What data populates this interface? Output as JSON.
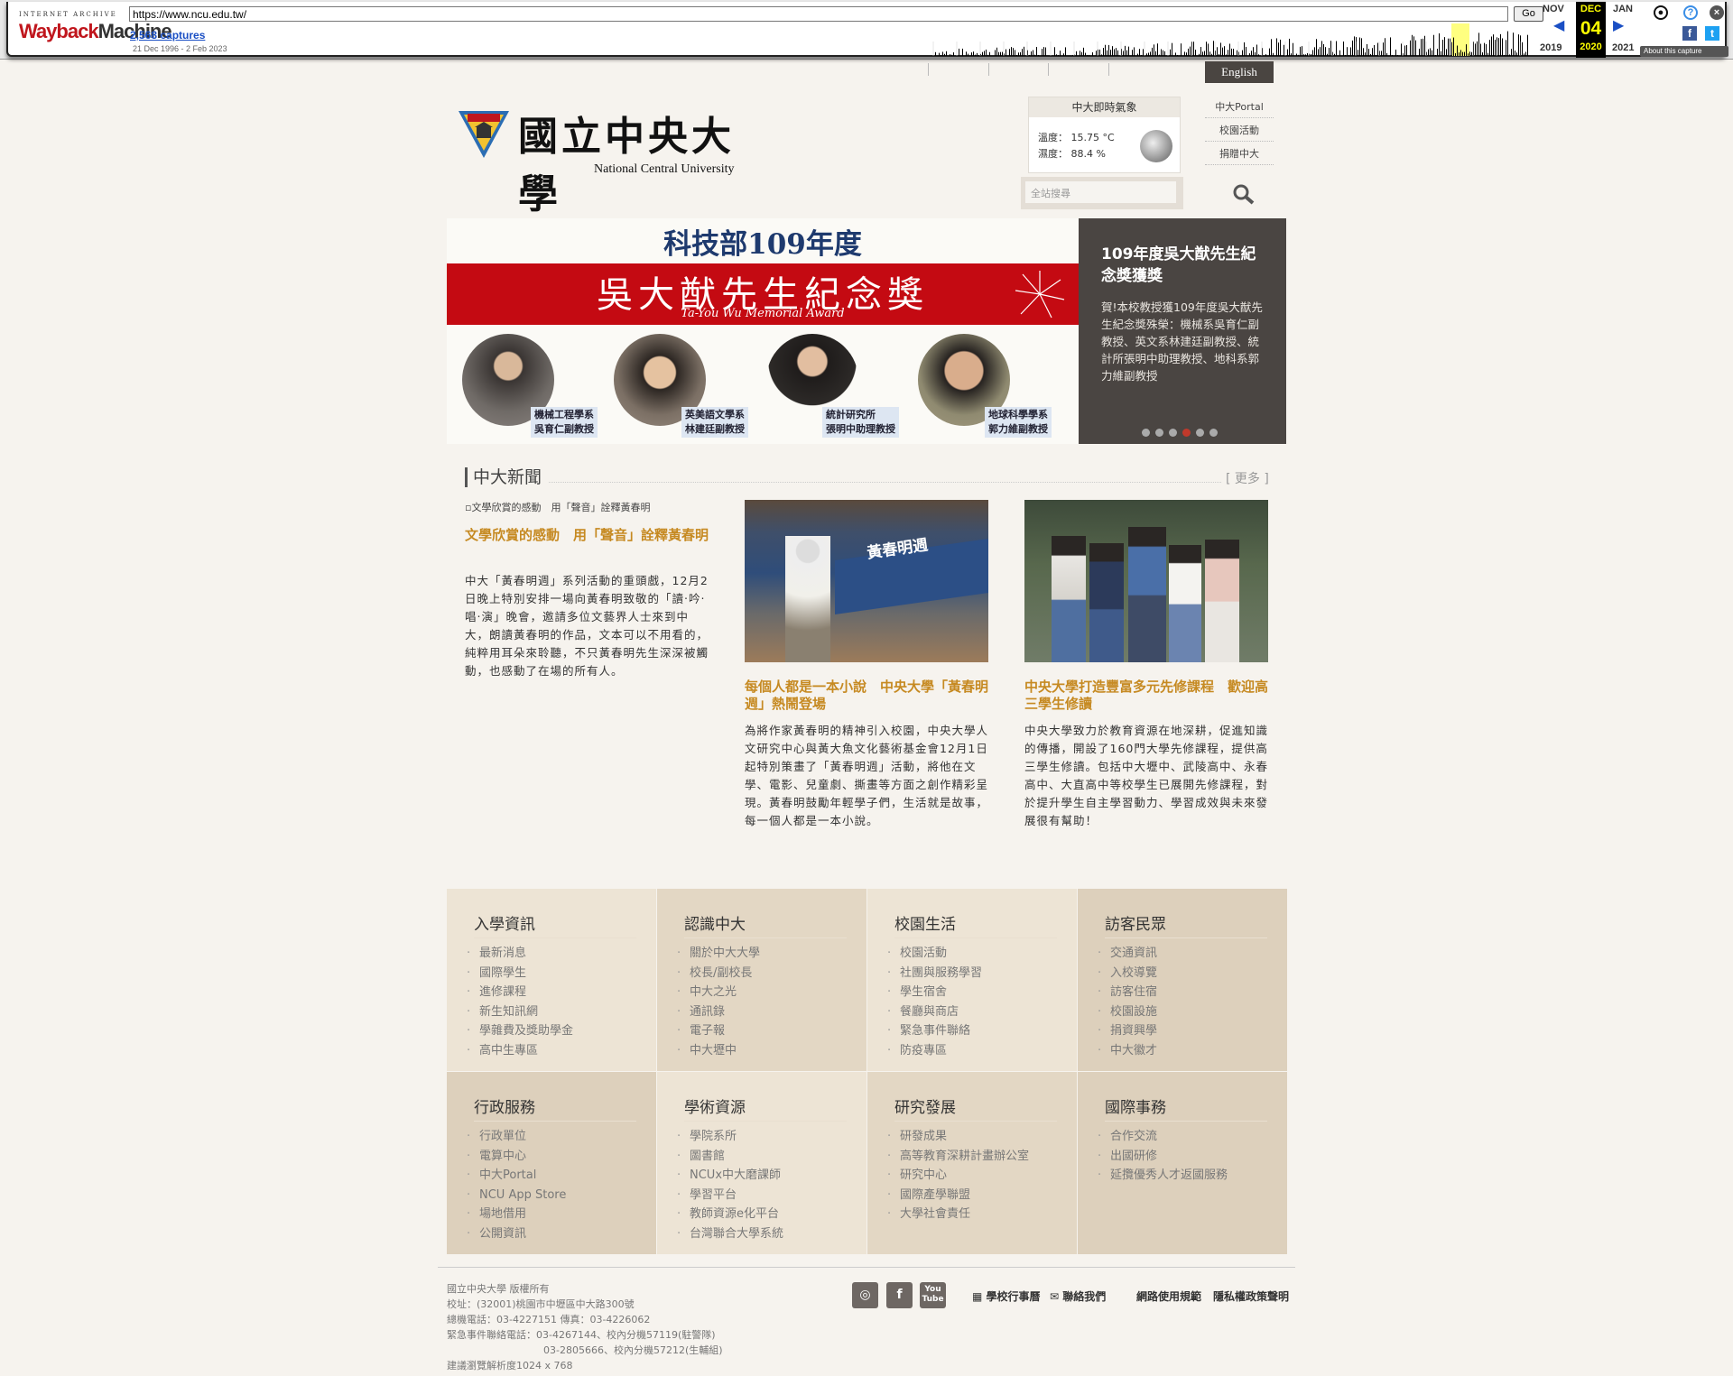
{
  "wayback": {
    "label_top": "INTERNET ARCHIVE",
    "brand_a": "Wayback",
    "brand_b": "Machine",
    "url": "https://www.ncu.edu.tw/",
    "go": "Go",
    "captures": "2,568 captures",
    "range": "21 Dec 1996 - 2 Feb 2023",
    "prev_month": "NOV",
    "cur_month": "DEC",
    "next_month": "JAN",
    "cur_day": "04",
    "prev_year": "2019",
    "cur_year": "2020",
    "next_year": "2021",
    "about": "About this capture"
  },
  "header": {
    "english": "English",
    "logo_zh": "國立中央大學",
    "logo_en": "National Central University"
  },
  "weather": {
    "title": "中大即時氣象",
    "temp": "溫度： 15.75 °C",
    "humidity": "濕度： 88.4 %"
  },
  "quick_links": [
    "中大Portal",
    "校園活動",
    "捐贈中大"
  ],
  "search": {
    "placeholder": "全站搜尋"
  },
  "banner": {
    "line1": "科技部109年度",
    "line2": "吳大猷先生紀念獎",
    "line3": "Ta-You Wu Memorial Award",
    "people": [
      {
        "dept": "機械工程學系",
        "name": "吳育仁副教授"
      },
      {
        "dept": "英美語文學系",
        "name": "林建廷副教授"
      },
      {
        "dept": "統計研究所",
        "name": "張明中助理教授"
      },
      {
        "dept": "地球科學學系",
        "name": "郭力維副教授"
      }
    ],
    "side_title": "109年度吳大猷先生紀念獎獲獎",
    "side_desc": "賀!本校教授獲109年度吳大猷先生紀念獎殊榮：機械系吳育仁副教授、英文系林建廷副教授、統計所張明中助理教授、地科系郭力維副教授",
    "active_slide": 4,
    "slide_count": 6
  },
  "news": {
    "heading": "中大新聞",
    "more": "[ 更多 ]",
    "items": [
      {
        "img_alt": "文學欣賞的感動　用「聲音」詮釋黃春明",
        "title": "文學欣賞的感動　用「聲音」詮釋黃春明",
        "desc": "中大「黃春明週」系列活動的重頭戲，12月2日晚上特別安排一場向黃春明致敬的「讀‧吟‧唱‧演」晚會，邀請多位文藝界人士來到中大，朗讀黃春明的作品，文本可以不用看的，純粹用耳朵來聆聽，不只黃春明先生深深被觸動，也感動了在場的所有人。"
      },
      {
        "photo_text": "黃春明週",
        "title": "每個人都是一本小說　中央大學「黃春明週」熱鬧登場",
        "desc": "為將作家黃春明的精神引入校園，中央大學人文研究中心與黃大魚文化藝術基金會12月1日起特別策畫了「黃春明週」活動，將他在文學、電影、兒童劇、撕畫等方面之創作精彩呈現。黃春明鼓勵年輕學子們，生活就是故事，每一個人都是一本小說。"
      },
      {
        "title": "中央大學打造豐富多元先修課程　歡迎高三學生修讀",
        "desc": "中央大學致力於教育資源在地深耕，促進知識的傳播，開設了160門大學先修課程，提供高三學生修讀。包括中大壢中、武陵高中、永春高中、大直高中等校學生已展開先修課程，對於提升學生自主學習動力、學習成效與未來發展很有幫助！"
      }
    ]
  },
  "menu": [
    {
      "title": "入學資訊",
      "items": [
        "最新消息",
        "國際學生",
        "進修課程",
        "新生知訊網",
        "學雜費及獎助學金",
        "高中生專區"
      ]
    },
    {
      "title": "認識中大",
      "items": [
        "關於中大大學",
        "校長/副校長",
        "中大之光",
        "通訊錄",
        "電子報",
        "中大壢中"
      ]
    },
    {
      "title": "校園生活",
      "items": [
        "校園活動",
        "社團與服務學習",
        "學生宿舍",
        "餐廳與商店",
        "緊急事件聯絡",
        "防疫專區"
      ]
    },
    {
      "title": "訪客民眾",
      "items": [
        "交通資訊",
        "入校導覽",
        "訪客住宿",
        "校園設施",
        "捐資興學",
        "中大徽才"
      ]
    },
    {
      "title": "行政服務",
      "items": [
        "行政單位",
        "電算中心",
        "中大Portal",
        "NCU App Store",
        "場地借用",
        "公開資訊"
      ]
    },
    {
      "title": "學術資源",
      "items": [
        "學院系所",
        "圖書館",
        "NCUx中大磨課師",
        "學習平台",
        "教師資源e化平台",
        "台灣聯合大學系統"
      ]
    },
    {
      "title": "研究發展",
      "items": [
        "研發成果",
        "高等教育深耕計畫辦公室",
        "研究中心",
        "國際產學聯盟",
        "大學社會責任"
      ]
    },
    {
      "title": "國際事務",
      "items": [
        "合作交流",
        "出國研修",
        "延攬優秀人才返國服務"
      ]
    }
  ],
  "footer": {
    "lines": [
      "國立中央大學 版權所有",
      "校址：(32001)桃園市中壢區中大路300號",
      "總機電話：03-4227151  傳真：03-4226062",
      "緊急事件聯絡電話：03-4267144、校內分機57119(駐警隊)",
      "03-2805666、校內分機57212(生輔組)",
      "建議瀏覽解析度1024 x 768"
    ],
    "social": [
      "instagram-icon",
      "facebook-icon",
      "youtube-icon"
    ],
    "youtube_label": "You Tube",
    "links": [
      "學校行事曆",
      "聯絡我們",
      "網路使用規範",
      "隱私權政策聲明"
    ]
  },
  "colors": {
    "accent_title": "#c68a22",
    "banner_red": "#c40a12",
    "banner_side": "#4a4542",
    "menu_1": "#ede4d5",
    "menu_2": "#e3d7c4",
    "menu_3": "#ddd0bc"
  }
}
